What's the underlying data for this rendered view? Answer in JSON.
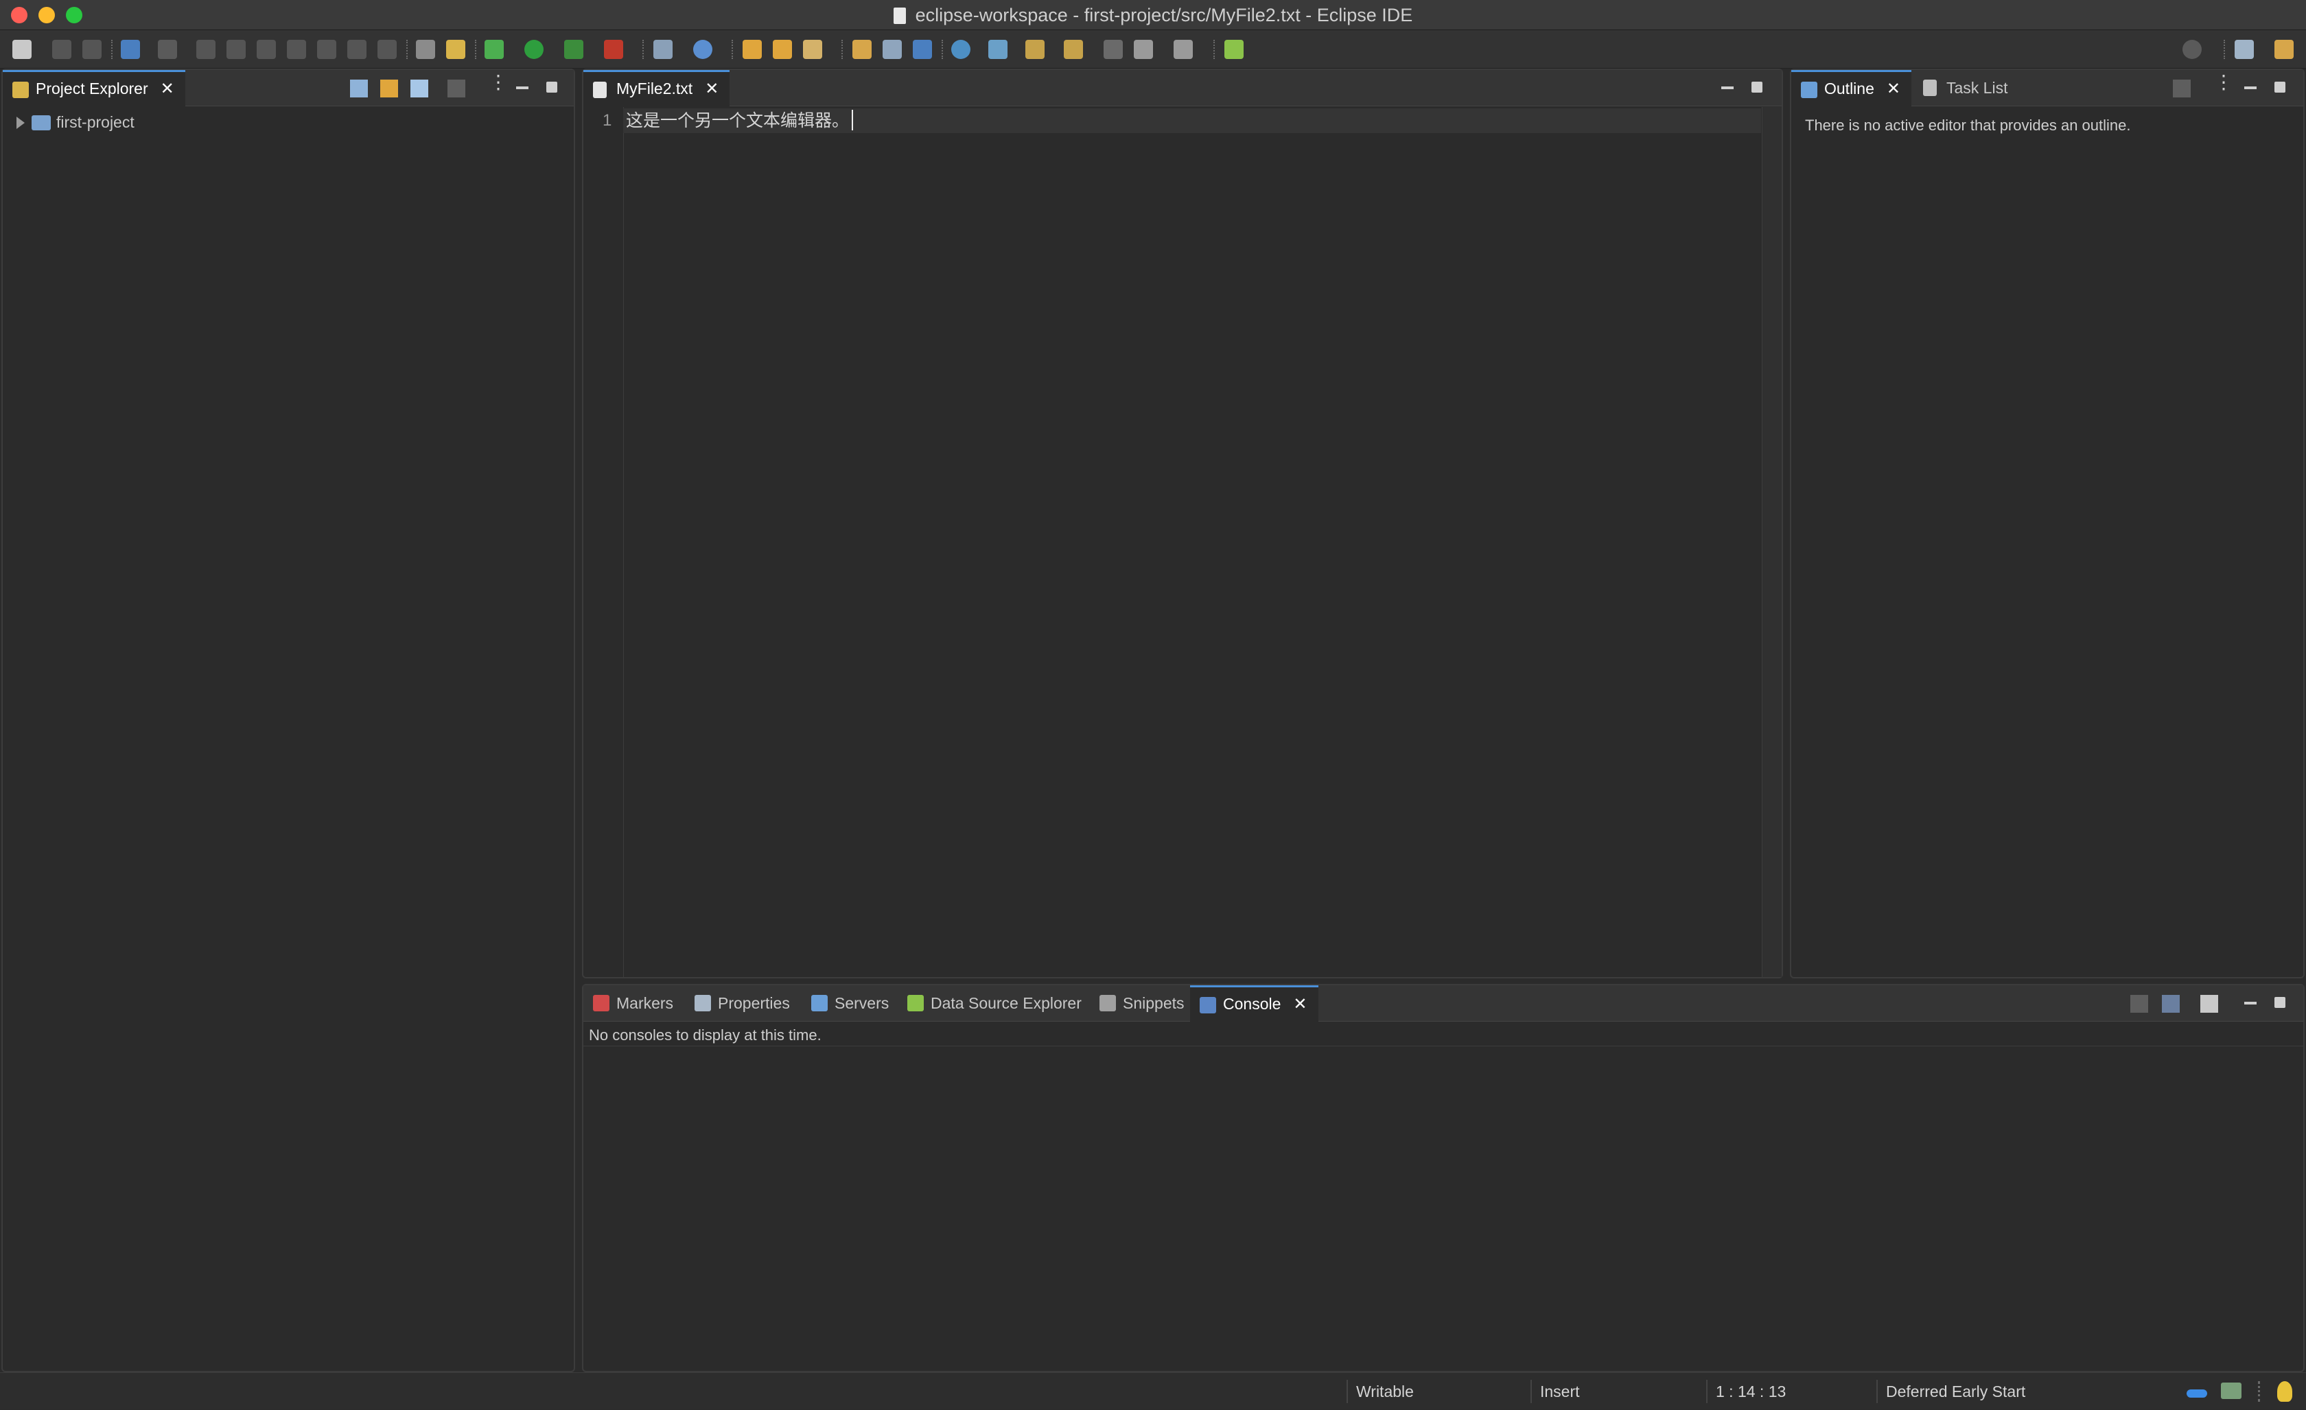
{
  "window": {
    "title": "eclipse-workspace - first-project/src/MyFile2.txt - Eclipse IDE"
  },
  "colors": {
    "close": "#ff5f57",
    "minimize": "#febc2e",
    "zoom": "#28c840",
    "accent": "#4a90d9",
    "background": "#2b2b2b"
  },
  "project_explorer": {
    "tab_label": "Project Explorer",
    "tree": [
      {
        "label": "first-project",
        "expanded": false
      }
    ]
  },
  "editor": {
    "tab_label": "MyFile2.txt",
    "line_number": "1",
    "content": "这是一个另一个文本编辑器。"
  },
  "outline": {
    "tabs": [
      {
        "label": "Outline",
        "active": true
      },
      {
        "label": "Task List",
        "active": false
      }
    ],
    "message": "There is no active editor that provides an outline."
  },
  "bottom_panel": {
    "tabs": [
      {
        "label": "Markers",
        "icon": "markers-icon"
      },
      {
        "label": "Properties",
        "icon": "properties-icon"
      },
      {
        "label": "Servers",
        "icon": "servers-icon"
      },
      {
        "label": "Data Source Explorer",
        "icon": "data-source-icon"
      },
      {
        "label": "Snippets",
        "icon": "snippets-icon"
      },
      {
        "label": "Console",
        "icon": "console-icon",
        "active": true
      }
    ],
    "message": "No consoles to display at this time."
  },
  "status": {
    "writable": "Writable",
    "insert_mode": "Insert",
    "position": "1 : 14 : 13",
    "job": "Deferred Early Start"
  }
}
